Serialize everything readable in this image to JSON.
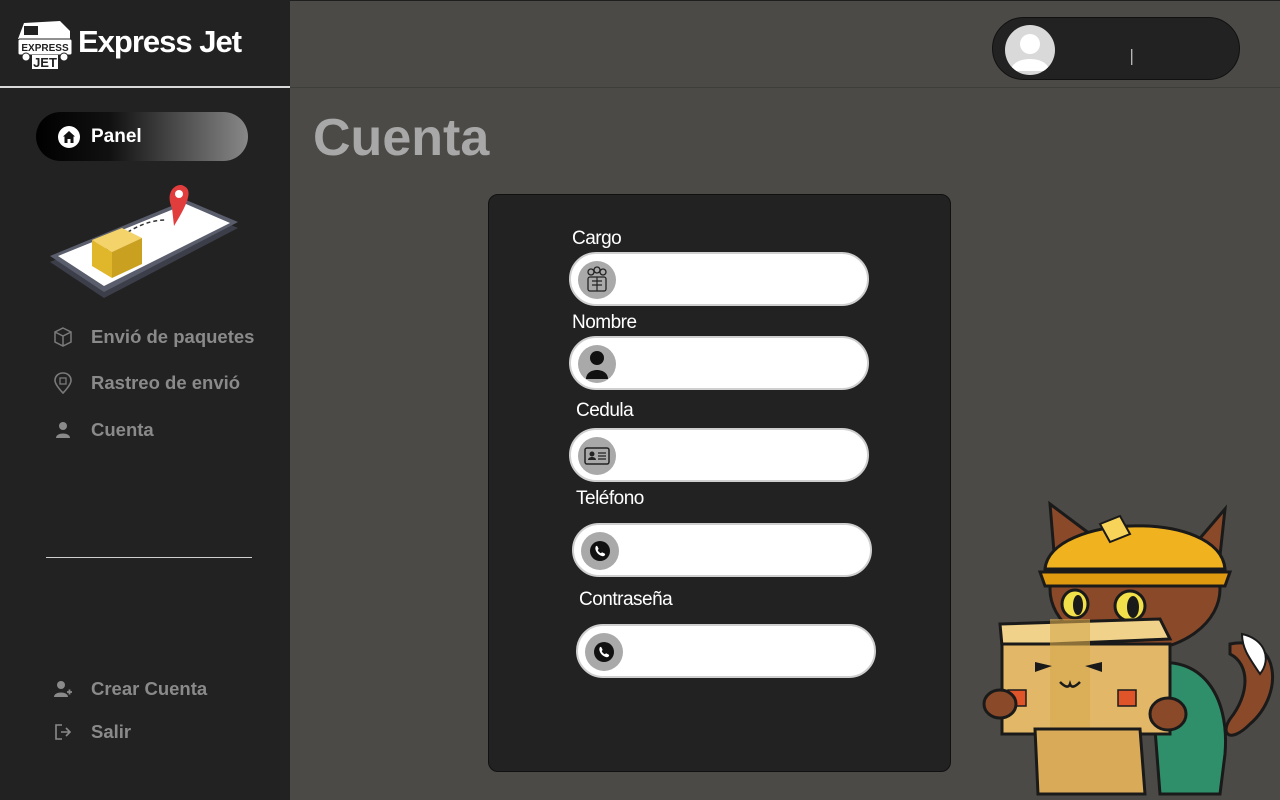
{
  "brand": {
    "name": "Express Jet",
    "logo_text_top": "EXPRESS",
    "logo_text_bottom": "JET"
  },
  "sidebar": {
    "panel_label": "Panel",
    "items": [
      {
        "label": "Envió de paquetes",
        "icon": "package-icon"
      },
      {
        "label": "Rastreo de envió",
        "icon": "location-pin-icon"
      },
      {
        "label": "Cuenta",
        "icon": "user-icon"
      }
    ],
    "bottom_items": [
      {
        "label": "Crear Cuenta",
        "icon": "add-user-icon"
      },
      {
        "label": "Salir",
        "icon": "logout-icon"
      }
    ]
  },
  "header": {
    "user_name": "|"
  },
  "page": {
    "title": "Cuenta"
  },
  "form": {
    "fields": [
      {
        "label": "Cargo",
        "value": "",
        "icon": "group-icon"
      },
      {
        "label": "Nombre",
        "value": "",
        "icon": "person-icon"
      },
      {
        "label": "Cedula",
        "value": "",
        "icon": "id-card-icon"
      },
      {
        "label": "Teléfono",
        "value": "",
        "icon": "phone-icon"
      },
      {
        "label": "Contraseña",
        "value": "",
        "icon": "phone-icon"
      }
    ]
  },
  "colors": {
    "background": "#4b4a46",
    "sidebar": "#222222",
    "card": "#222222",
    "muted_text": "#8a8a8a"
  }
}
